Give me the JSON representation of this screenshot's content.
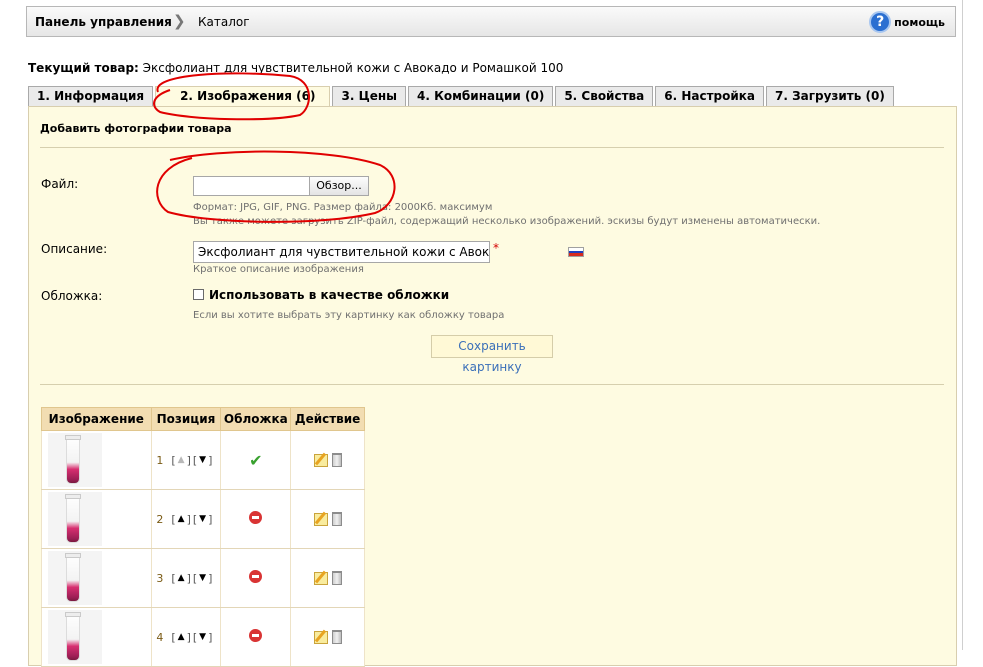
{
  "breadcrumb": {
    "root": "Панель управления",
    "separator": "❯",
    "current": "Каталог"
  },
  "help": {
    "label": "помощь",
    "glyph": "?"
  },
  "current_product": {
    "label": "Текущий товар:",
    "value": "Эксфолиант для чувствительной кожи с Авокадо и Ромашкой 100"
  },
  "tabs": [
    {
      "label": "1. Информация"
    },
    {
      "label": "2. Изображения (6)"
    },
    {
      "label": "3. Цены"
    },
    {
      "label": "4. Комбинации (0)"
    },
    {
      "label": "5. Свойства"
    },
    {
      "label": "6. Настройка"
    },
    {
      "label": "7. Загрузить (0)"
    }
  ],
  "section": {
    "title": "Добавить фотографии товара"
  },
  "form": {
    "file_label": "Файл:",
    "browse": "Обзор...",
    "file_hint_1": "Формат: JPG, GIF, PNG. Размер файла: 2000Кб. максимум",
    "file_hint_2": "Вы также можете загрузить ZIP-файл, содержащий несколько изображений. эскизы будут изменены автоматически.",
    "desc_label": "Описание:",
    "desc_value": "Эксфолиант для чувствительной кожи с Авокадо и",
    "desc_required": "*",
    "desc_hint": "Краткое описание изображения",
    "cover_label": "Обложка:",
    "cover_checkbox": "Использовать в качестве обложки",
    "cover_hint": "Если вы хотите выбрать эту картинку как обложку товара",
    "save": "Сохранить картинку"
  },
  "flag_colors": [
    "#ffffff",
    "#1f3fbf",
    "#d52b1e"
  ],
  "table": {
    "headers": [
      "Изображение",
      "Позиция",
      "Обложка",
      "Действие"
    ],
    "rows": [
      {
        "position": "1",
        "up_enabled": false,
        "cover": true
      },
      {
        "position": "2",
        "up_enabled": true,
        "cover": false
      },
      {
        "position": "3",
        "up_enabled": true,
        "cover": false
      },
      {
        "position": "4",
        "up_enabled": true,
        "cover": false
      }
    ],
    "arrow_up": "▲",
    "arrow_down": "▼",
    "bracket_l": "[",
    "bracket_r": "]",
    "cover_ok_glyph": "✔"
  }
}
